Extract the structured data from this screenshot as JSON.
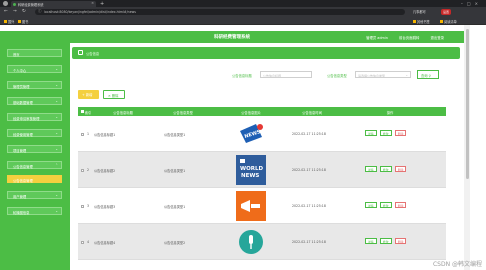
{
  "browser": {
    "tab_title": "科研经费管理系统",
    "url": "localhost:8080/keyanjingfei/admin/dist/index.html#/news",
    "bookmarks": [
      "国外",
      "图书"
    ],
    "extensions": [
      "凡事都可",
      "设置"
    ],
    "right_bookmarks": [
      "其他书签",
      "阅读清单"
    ]
  },
  "header": {
    "title": "科研经费管理系统",
    "links": [
      "管理员 admin",
      "前台页面跳转",
      "退出登录"
    ]
  },
  "sidebar": {
    "items": [
      {
        "label": "首页",
        "active": false
      },
      {
        "label": "个人中心",
        "active": false
      },
      {
        "label": "管理员管理",
        "active": false
      },
      {
        "label": "基础数据管理",
        "active": false
      },
      {
        "label": "经费申请审核管理",
        "active": false
      },
      {
        "label": "经费使用管理",
        "active": false
      },
      {
        "label": "项目管理",
        "active": false
      },
      {
        "label": "公告信息管理",
        "active": false
      },
      {
        "label": "公告信息管理",
        "active": true
      },
      {
        "label": "用户管理",
        "active": false
      },
      {
        "label": "轮播图信息",
        "active": false
      }
    ]
  },
  "breadcrumb": {
    "text": "公告信息"
  },
  "search": {
    "title_label": "公告信息标题",
    "title_placeholder": "公告信息标题",
    "type_label": "公告信息类型",
    "type_placeholder": "请选择公告信息类型",
    "button": "查询"
  },
  "actions": {
    "add": "新增",
    "delete": "删除"
  },
  "table": {
    "headers": [
      "索引",
      "公告信息标题",
      "公告信息类型",
      "公告信息图片",
      "公告信息时间",
      "操作"
    ],
    "row_actions": [
      "详情",
      "修改",
      "删除"
    ],
    "rows": [
      {
        "index": "1",
        "title": "公告信息标题1",
        "type": "公告信息类型1",
        "image": "news-red-megaphone",
        "time": "2022-02-17 11:25:18"
      },
      {
        "index": "2",
        "title": "公告信息标题2",
        "type": "公告信息类型1",
        "image": "world-news",
        "time": "2022-02-17 11:25:18"
      },
      {
        "index": "3",
        "title": "公告信息标题3",
        "type": "公告信息类型1",
        "image": "news-orange",
        "time": "2022-02-17 11:25:18"
      },
      {
        "index": "4",
        "title": "公告信息标题4",
        "type": "公告信息类型2",
        "image": "microphone-teal",
        "time": "2022-02-17 11:25:18"
      }
    ]
  },
  "watermark": "CSDN @韩文编程",
  "colors": {
    "accent": "#4cbd45",
    "highlight": "#f4d03f",
    "danger": "#e57373"
  }
}
